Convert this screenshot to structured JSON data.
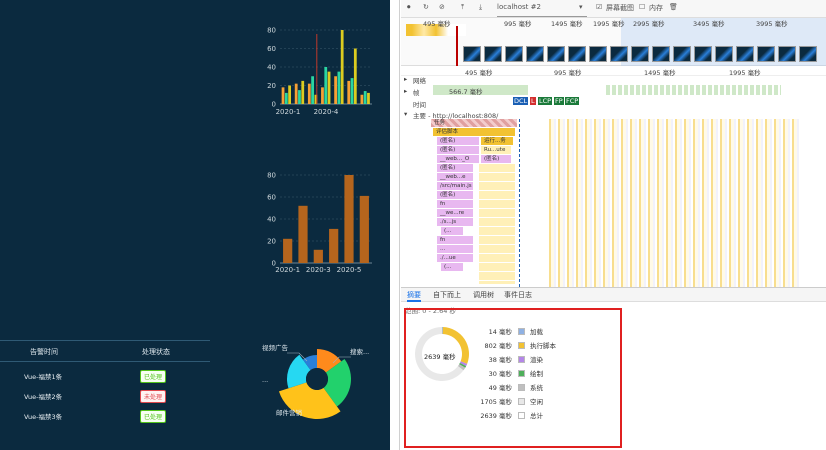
{
  "left": {
    "bar_chart_1": {
      "categories": [
        "2020-1",
        "2020-4"
      ],
      "y_ticks": [
        "0",
        "20",
        "40",
        "60",
        "80"
      ]
    },
    "bar_chart_2": {
      "categories": [
        "2020-1",
        "2020-3",
        "2020-5"
      ],
      "y_ticks": [
        "0",
        "20",
        "40",
        "60",
        "80"
      ]
    },
    "table": {
      "headers": [
        "告警时间",
        "处理状态"
      ],
      "rows": [
        {
          "name": "Vue-福禁1条",
          "status": "已处理",
          "color": "#52c41a"
        },
        {
          "name": "Vue-福禁2条",
          "status": "未处理",
          "color": "#e0484e"
        },
        {
          "name": "Vue-福禁3条",
          "status": "已处理",
          "color": "#52c41a"
        }
      ]
    },
    "pie_labels": [
      "视频广告",
      "搜索...",
      "邮件营销",
      "..."
    ]
  },
  "chart_data": [
    {
      "type": "bar",
      "categories": [
        "2020-1",
        "",
        "",
        "2020-4",
        "",
        "",
        ""
      ],
      "series": [
        {
          "values": [
            18,
            22,
            22,
            18,
            30,
            25,
            10
          ],
          "color": "#f7a035"
        },
        {
          "values": [
            12,
            15,
            30,
            40,
            35,
            28,
            14
          ],
          "color": "#2ad6a1"
        },
        {
          "values": [
            20,
            25,
            10,
            35,
            80,
            60,
            12
          ],
          "color": "#dccc20"
        }
      ],
      "ylim": [
        0,
        80
      ]
    },
    {
      "type": "bar",
      "categories": [
        "2020-1",
        "",
        "2020-3",
        "",
        "2020-5"
      ],
      "values": [
        22,
        52,
        12,
        31,
        80,
        61
      ],
      "ylim": [
        0,
        80
      ]
    },
    {
      "type": "pie",
      "labels": [
        "视频广告",
        "搜索...",
        "邮件营销",
        "..."
      ],
      "values": [
        15,
        25,
        30,
        20,
        10
      ],
      "colors": [
        "#ff8a1c",
        "#22d16c",
        "#ffc21a",
        "#26d8f2",
        "#2a7fd9"
      ]
    }
  ],
  "devtools": {
    "toolbar": {
      "target": "localhost #2",
      "screenshots": "屏幕截图",
      "memory": "内存"
    },
    "ruler": [
      "495 毫秒",
      "995 毫秒",
      "1495 毫秒",
      "1995 毫秒",
      "2995 毫秒",
      "3495 毫秒",
      "3995 毫秒"
    ],
    "ruler2": [
      "495 毫秒",
      "995 毫秒",
      "1495 毫秒",
      "1995 毫秒"
    ],
    "tracks": {
      "network": "网络",
      "frames": "帧",
      "frames_time": "566.7 毫秒",
      "timing": "时间",
      "main": "主要 - http://localhost:808/"
    },
    "markers": [
      "DCL",
      "L",
      "LCP",
      "FP",
      "FCP"
    ],
    "flames": [
      "任务",
      "评估脚本",
      "(匿名)",
      "运行...务",
      "(匿名)",
      "Ru...ute",
      "__web..._O",
      "(匿名)",
      "(匿名)",
      "__web...e",
      "/src/main.js",
      "(匿名)",
      "fn",
      "__we...re",
      "./s...js",
      "(...",
      "fn",
      "...",
      "./...ue",
      "(..."
    ],
    "tabs": [
      "摘要",
      "自下而上",
      "调用树",
      "事件日志"
    ],
    "range": "范围: 0 - 2.64 秒",
    "summary": {
      "total_center": "2639 毫秒",
      "items": [
        {
          "value": "14 毫秒",
          "name": "加载",
          "color": "#8fb1e3"
        },
        {
          "value": "802 毫秒",
          "name": "执行脚本",
          "color": "#f2c232"
        },
        {
          "value": "38 毫秒",
          "name": "渲染",
          "color": "#b486e8"
        },
        {
          "value": "30 毫秒",
          "name": "绘制",
          "color": "#4eaf5a"
        },
        {
          "value": "49 毫秒",
          "name": "系统",
          "color": "#bfbfbf"
        },
        {
          "value": "1705 毫秒",
          "name": "空闲",
          "color": "#e8e8e8"
        },
        {
          "value": "2639 毫秒",
          "name": "总计",
          "color": "#ffffff"
        }
      ]
    }
  }
}
